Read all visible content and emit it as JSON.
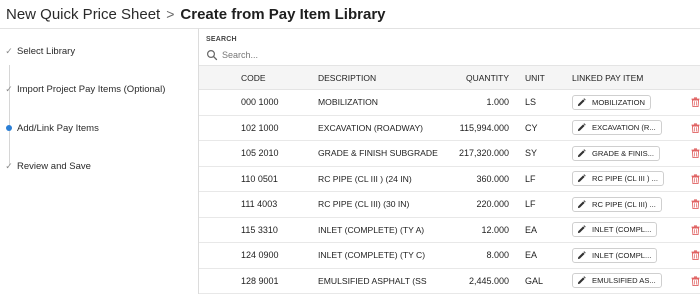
{
  "breadcrumb": {
    "parent": "New Quick Price Sheet",
    "separator": ">",
    "current": "Create from Pay Item Library"
  },
  "steps": [
    {
      "label": "Select Library",
      "state": "complete"
    },
    {
      "label": "Import Project Pay Items (Optional)",
      "state": "complete"
    },
    {
      "label": "Add/Link Pay Items",
      "state": "current"
    },
    {
      "label": "Review and Save",
      "state": "complete"
    }
  ],
  "search": {
    "label": "SEARCH",
    "placeholder": "Search..."
  },
  "table": {
    "columns": {
      "code": "CODE",
      "description": "DESCRIPTION",
      "quantity": "QUANTITY",
      "unit": "UNIT",
      "linked": "LINKED PAY ITEM"
    },
    "rows": [
      {
        "code": "000 1000",
        "description": "MOBILIZATION",
        "quantity": "1.000",
        "unit": "LS",
        "linked": "MOBILIZATION"
      },
      {
        "code": "102 1000",
        "description": "EXCAVATION (ROADWAY)",
        "quantity": "115,994.000",
        "unit": "CY",
        "linked": "EXCAVATION (R..."
      },
      {
        "code": "105 2010",
        "description": "GRADE & FINISH SUBGRADE",
        "quantity": "217,320.000",
        "unit": "SY",
        "linked": "GRADE & FINIS..."
      },
      {
        "code": "110 0501",
        "description": "RC PIPE (CL III ) (24 IN)",
        "quantity": "360.000",
        "unit": "LF",
        "linked": "RC PIPE (CL III ) ..."
      },
      {
        "code": "111 4003",
        "description": "RC PIPE (CL III) (30 IN)",
        "quantity": "220.000",
        "unit": "LF",
        "linked": "RC PIPE (CL III) ..."
      },
      {
        "code": "115 3310",
        "description": "INLET (COMPLETE) (TY A)",
        "quantity": "12.000",
        "unit": "EA",
        "linked": "INLET (COMPL..."
      },
      {
        "code": "124 0900",
        "description": "INLET (COMPLETE) (TY C)",
        "quantity": "8.000",
        "unit": "EA",
        "linked": "INLET (COMPL..."
      },
      {
        "code": "128 9001",
        "description": "EMULSIFIED ASPHALT (SS",
        "quantity": "2,445.000",
        "unit": "GAL",
        "linked": "EMULSIFIED AS..."
      }
    ]
  },
  "icons": {
    "step_complete": "checkmark-icon",
    "step_current": "current-step-dot-icon",
    "search": "search-icon",
    "edit": "pencil-icon",
    "delete": "trash-icon"
  },
  "colors": {
    "current_step": "#2b7fd6",
    "delete_icon": "#e06262",
    "header_bg": "#f5f5f5"
  }
}
